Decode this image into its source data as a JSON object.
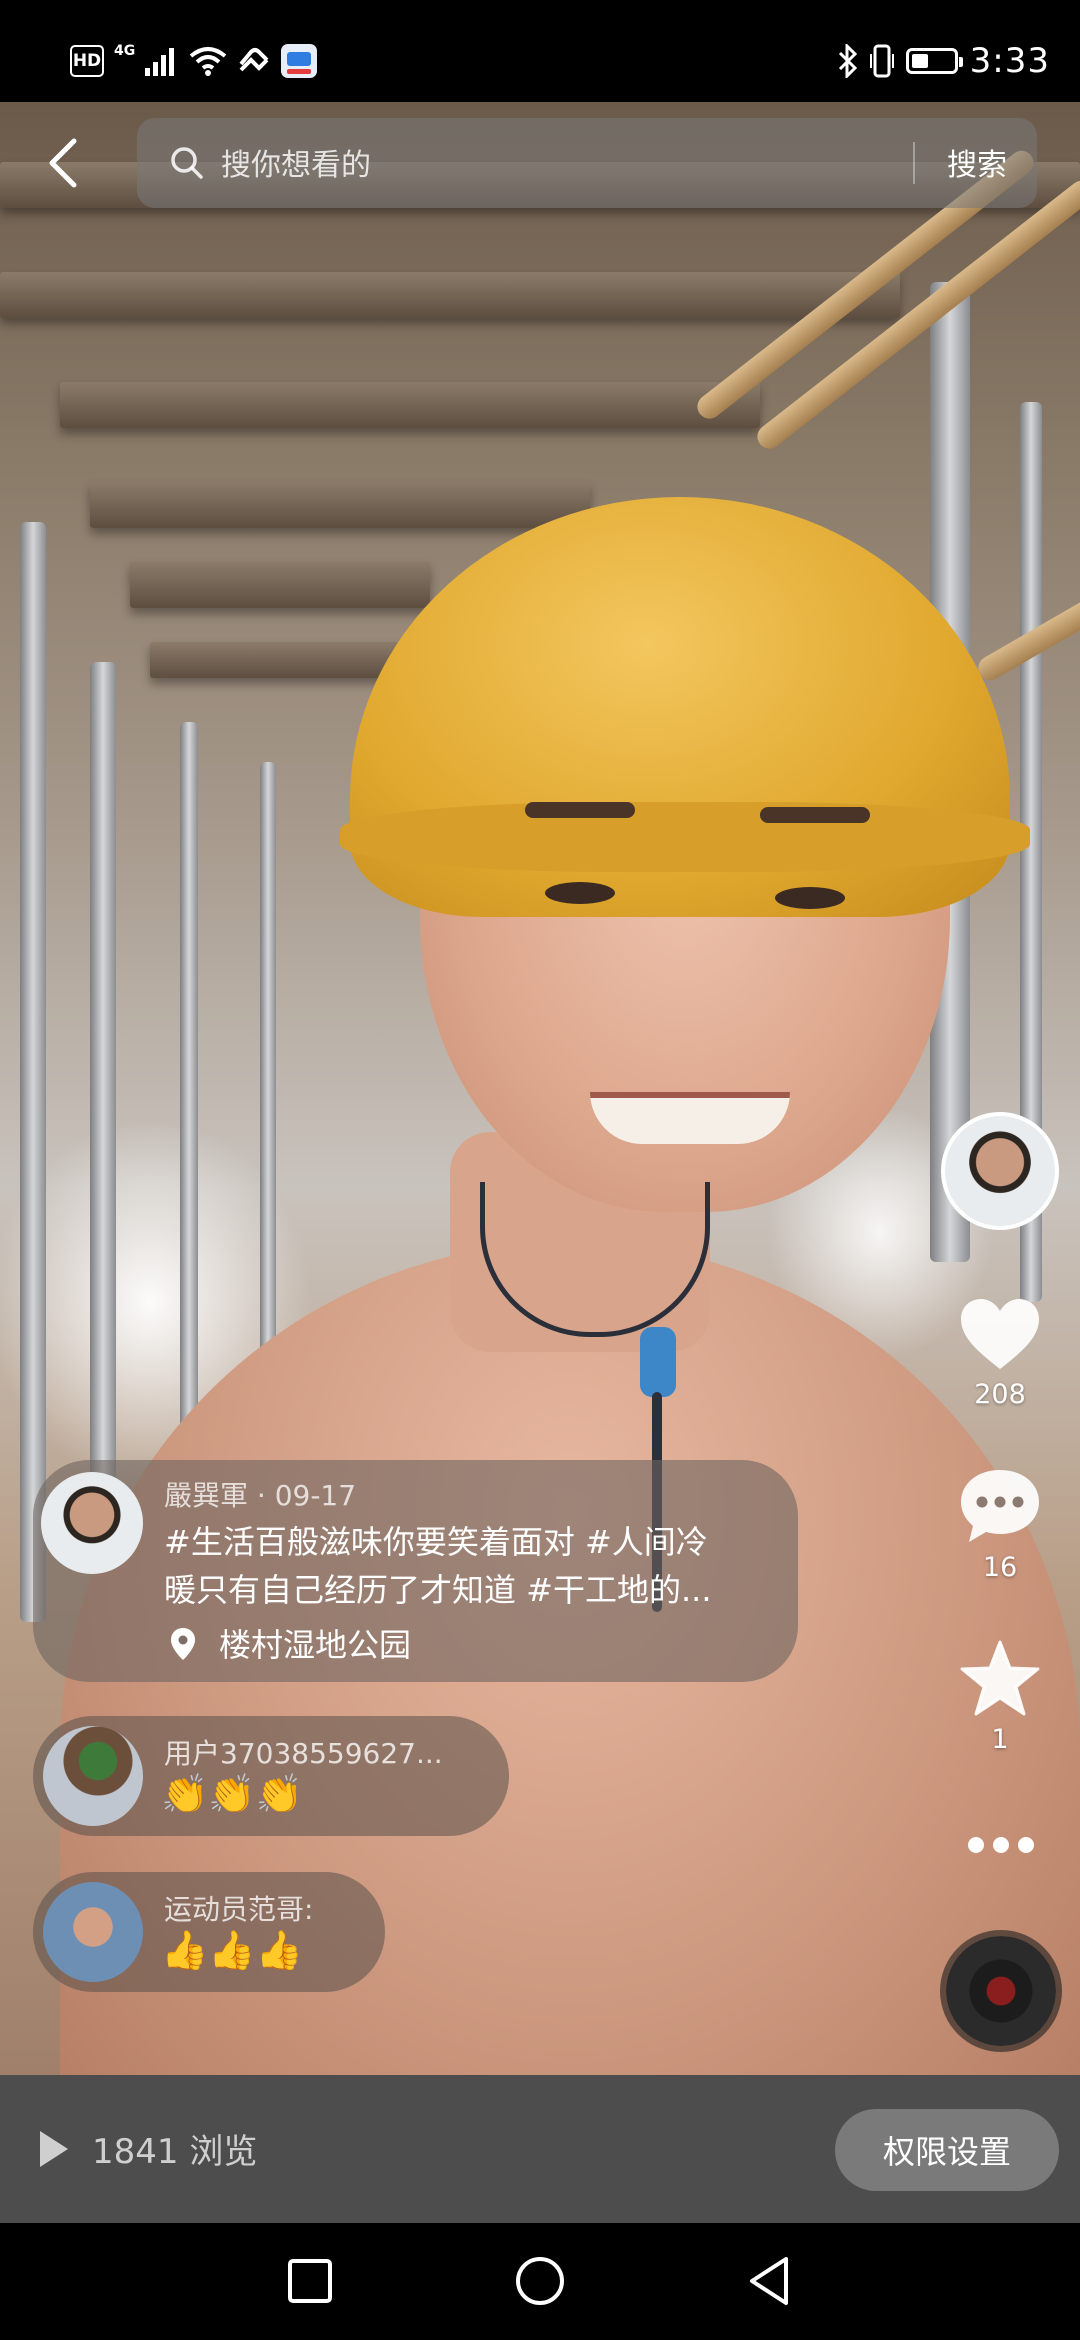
{
  "status_bar": {
    "hd_label": "HD",
    "network_label": "4G",
    "time": "3:33",
    "battery_level": 0.35,
    "icons": [
      "hd-icon",
      "signal-icon",
      "wifi-icon",
      "nfc-icon",
      "app-notification-icon",
      "bluetooth-icon",
      "vibrate-icon",
      "battery-icon"
    ]
  },
  "search": {
    "placeholder": "搜你想看的",
    "button_label": "搜索"
  },
  "actions": {
    "like_count": "208",
    "comment_count": "16",
    "favorite_count": "1"
  },
  "post": {
    "meta": "嚴巽軍 · 09-17",
    "text_line1": "#生活百般滋味你要笑着面对 #人间冷",
    "text_line2": "暖只有自己经历了才知道 #干工地的...",
    "location": "楼村湿地公园"
  },
  "comments": [
    {
      "user": "用户37038559627...",
      "text": "👏👏👏"
    },
    {
      "user": "运动员范哥:",
      "text": "👍👍👍"
    }
  ],
  "bottom_bar": {
    "views": "1841 浏览",
    "permission_button": "权限设置"
  },
  "colors": {
    "accent_white": "#ffffff",
    "helmet_yellow": "#e0a82e",
    "bottom_bar": "#4d4d4d",
    "button_gray": "#7a7a7a"
  }
}
